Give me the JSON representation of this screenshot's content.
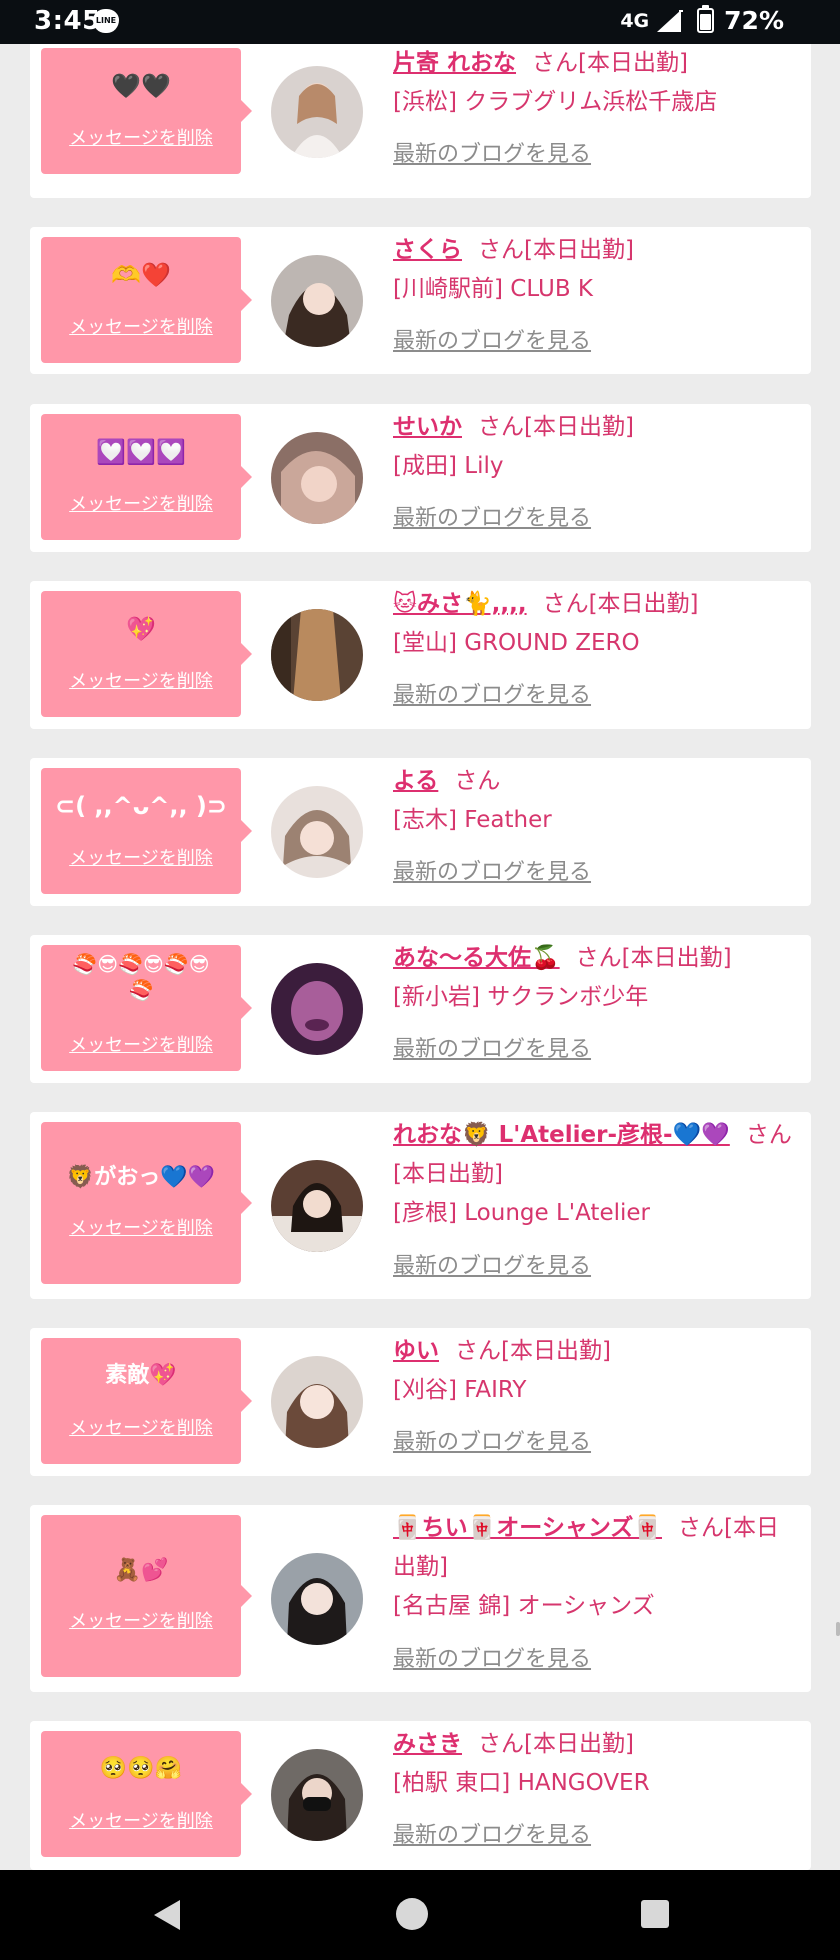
{
  "status_bar": {
    "time": "3:45",
    "app_icon": "line-icon",
    "app_icon_text": "LINE",
    "network": "4G",
    "battery": "72%"
  },
  "cards": [
    {
      "message": "🖤🖤",
      "delete_label": "メッセージを削除",
      "name": "片寄 れおな",
      "san": "さん[本日出勤]",
      "shop": "[浜松] クラブグリム浜松千歳店",
      "blog_label": "最新のブログを見る"
    },
    {
      "message": "🫶❤️",
      "delete_label": "メッセージを削除",
      "name": "さくら",
      "san": "さん[本日出勤]",
      "shop": "[川崎駅前] CLUB K",
      "blog_label": "最新のブログを見る"
    },
    {
      "message": "💟💟💟",
      "delete_label": "メッセージを削除",
      "name": "せいか",
      "san": "さん[本日出勤]",
      "shop": "[成田] Lily",
      "blog_label": "最新のブログを見る"
    },
    {
      "message": "💖",
      "delete_label": "メッセージを削除",
      "name": "🐱みさ🐈,,,,",
      "san": "さん[本日出勤]",
      "shop": "[堂山] GROUND ZERO",
      "blog_label": "最新のブログを見る"
    },
    {
      "message": "⊂( ,,^ᴗ^,, )⊃",
      "delete_label": "メッセージを削除",
      "name": "よる",
      "san": "さん",
      "shop": "[志木] Feather",
      "blog_label": "最新のブログを見る"
    },
    {
      "message": "🍣😎🍣😎🍣😎\n🍣",
      "delete_label": "メッセージを削除",
      "name": "あな～る大佐🍒",
      "san": "さん[本日出勤]",
      "shop": "[新小岩] サクランボ少年",
      "blog_label": "最新のブログを見る"
    },
    {
      "message": "🦁がおっ💙💜",
      "delete_label": "メッセージを削除",
      "name": "れおな🦁 L'Atelier-彦根-💙💜",
      "san": "さん",
      "san_line2": "[本日出勤]",
      "shop": "[彦根] Lounge L'Atelier",
      "blog_label": "最新のブログを見る"
    },
    {
      "message": "素敵💖",
      "delete_label": "メッセージを削除",
      "name": "ゆい",
      "san": "さん[本日出勤]",
      "shop": "[刈谷] FAIRY",
      "blog_label": "最新のブログを見る"
    },
    {
      "message": "🧸💕",
      "delete_label": "メッセージを削除",
      "name": "🀄ちい🀄オーシャンズ🀄",
      "san": "さん[本日",
      "san_line2": "出勤]",
      "shop": "[名古屋 錦] オーシャンズ",
      "blog_label": "最新のブログを見る"
    },
    {
      "message": "🥺🥺🤗",
      "delete_label": "メッセージを削除",
      "name": "みさき",
      "san": "さん[本日出勤]",
      "shop": "[柏駅 東口] HANGOVER",
      "blog_label": "最新のブログを見る"
    }
  ],
  "nav_bar": {
    "back_icon": "back-triangle-icon",
    "home_icon": "home-circle-icon",
    "recents_icon": "recents-square-icon"
  },
  "colors": {
    "accent": "#dd2f6f",
    "message_bg": "#ff97a9",
    "blog_link": "#8c8c8c",
    "page_bg": "#ececec"
  }
}
